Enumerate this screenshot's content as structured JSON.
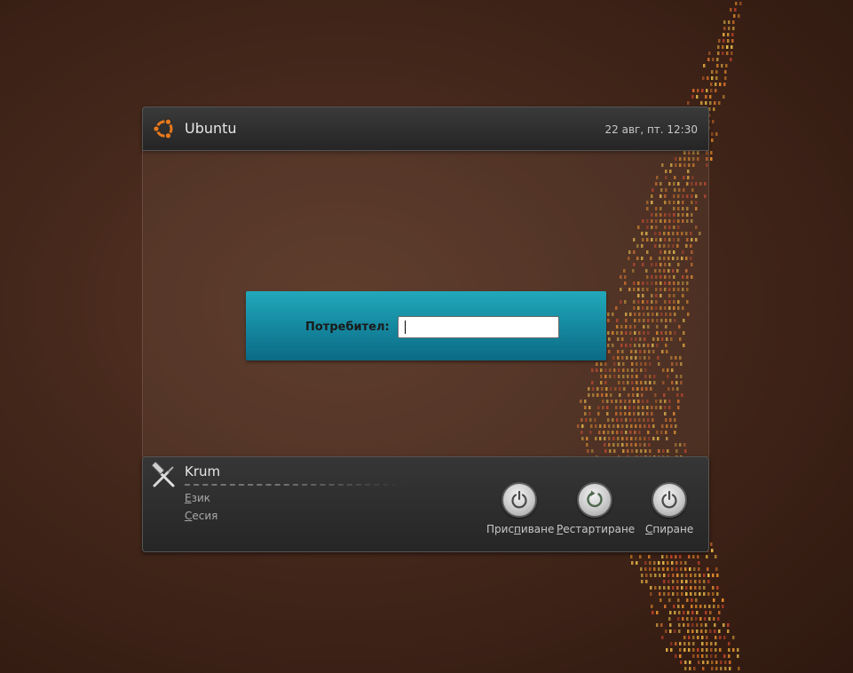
{
  "header": {
    "title": "Ubuntu",
    "datetime": "22 авг, пт. 12:30",
    "logo_icon": "ubuntu-logo-icon"
  },
  "login": {
    "username_label": "Потребител:",
    "username_value": ""
  },
  "user_panel": {
    "name": "Krum",
    "icon": "tools-icon",
    "language_menu": {
      "mnemonic": "Е",
      "rest": "зик"
    },
    "session_menu": {
      "mnemonic": "С",
      "rest": "есия"
    }
  },
  "actions": [
    {
      "pre": "Прис",
      "mnemonic": "п",
      "post": "иване",
      "icon": "power-icon"
    },
    {
      "pre": "",
      "mnemonic": "Р",
      "post": "естартиране",
      "icon": "restart-icon"
    },
    {
      "pre": "",
      "mnemonic": "С",
      "post": "пиране",
      "icon": "power-icon"
    }
  ],
  "colors": {
    "login_accent": "#168ca2",
    "background": "#44271b",
    "wallpaper_dots": "#e0892a"
  }
}
